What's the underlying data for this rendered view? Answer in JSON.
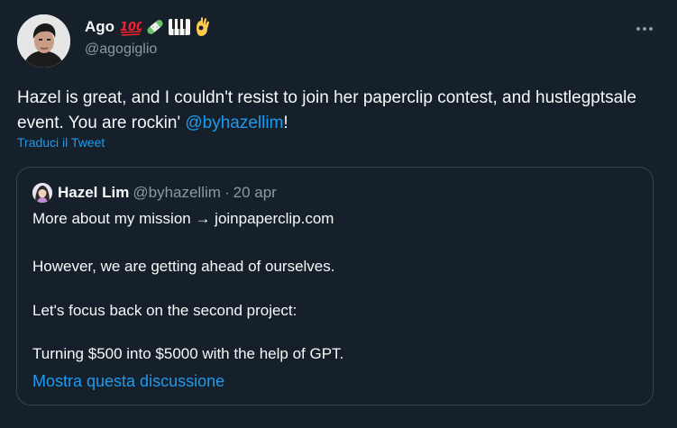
{
  "author": {
    "name": "Ago",
    "handle": "@agogiglio",
    "emojis": [
      "hundred-points-emoji",
      "bandage-emoji",
      "piano-keys-emoji",
      "ok-hand-emoji"
    ]
  },
  "tweet": {
    "text_before": "Hazel is great, and I couldn't resist to join her paperclip contest, and hustlegptsale event. You are rockin' ",
    "mention": "@byhazellim",
    "text_after": "!",
    "translate_label": "Traduci il Tweet"
  },
  "quoted_tweet": {
    "name": "Hazel Lim",
    "handle": "@byhazellim",
    "separator": "·",
    "date": "20 apr",
    "lines": [
      "More about my mission → joinpaperclip.com",
      "However, we are getting ahead of ourselves.",
      "Let's focus back on the second project:",
      "Turning $500 into $5000 with the help of GPT."
    ],
    "thread_link": "Mostra questa discussione"
  },
  "colors": {
    "background": "#15202b",
    "text": "#f7f9f9",
    "secondary_text": "#8b98a5",
    "accent": "#1d9bf0",
    "border": "#38444d"
  }
}
